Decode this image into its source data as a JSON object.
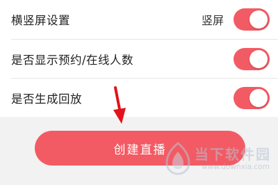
{
  "settings": {
    "rows": [
      {
        "label": "横竖屏设置",
        "value": "竖屏",
        "toggle_on": true
      },
      {
        "label": "是否显示预约/在线人数",
        "value": "",
        "toggle_on": true
      },
      {
        "label": "是否生成回放",
        "value": "",
        "toggle_on": true
      }
    ]
  },
  "actions": {
    "create_label": "创建直播"
  },
  "watermark": {
    "brand": "当下软件园",
    "url": "www.downxia.com"
  },
  "colors": {
    "accent": "#f25b64",
    "arrow": "#e2131b",
    "background": "#f2f2f2"
  }
}
